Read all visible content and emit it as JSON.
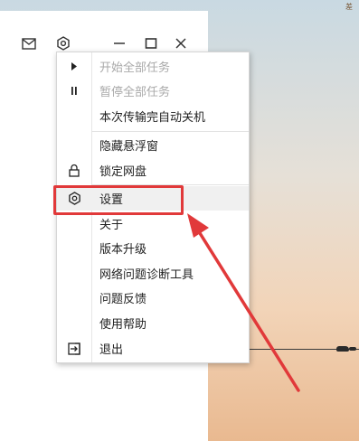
{
  "wallpaper": {
    "corner_text": "差"
  },
  "titlebar": {
    "icons": [
      "mail-icon",
      "gear-icon",
      "minimize-icon",
      "maximize-icon",
      "close-icon"
    ]
  },
  "menu": {
    "items": [
      {
        "label": "开始全部任务",
        "icon": "play-icon",
        "disabled": true
      },
      {
        "label": "暂停全部任务",
        "icon": "pause-icon",
        "disabled": true
      },
      {
        "label": "本次传输完自动关机",
        "icon": "",
        "disabled": false
      },
      {
        "label": "隐藏悬浮窗",
        "icon": "",
        "disabled": false
      },
      {
        "label": "锁定网盘",
        "icon": "lock-icon",
        "disabled": false
      },
      {
        "label": "设置",
        "icon": "gear-icon",
        "disabled": false
      },
      {
        "label": "关于",
        "icon": "",
        "disabled": false
      },
      {
        "label": "版本升级",
        "icon": "",
        "disabled": false
      },
      {
        "label": "网络问题诊断工具",
        "icon": "",
        "disabled": false
      },
      {
        "label": "问题反馈",
        "icon": "",
        "disabled": false
      },
      {
        "label": "使用帮助",
        "icon": "",
        "disabled": false
      },
      {
        "label": "退出",
        "icon": "exit-icon",
        "disabled": false
      }
    ]
  },
  "annotation": {
    "highlight_color": "#e1393a",
    "highlighted_item": "设置"
  }
}
